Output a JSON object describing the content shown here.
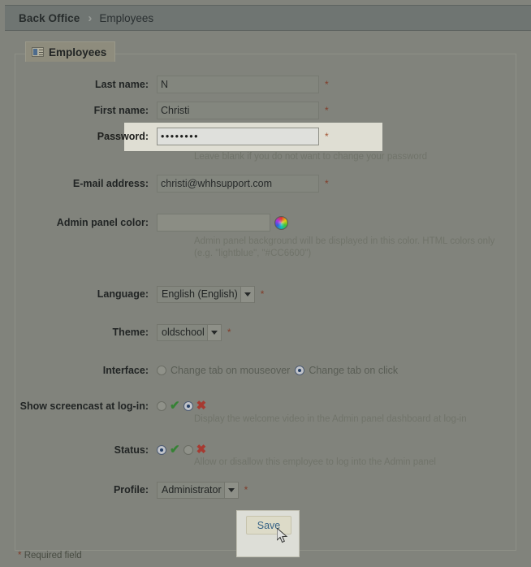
{
  "breadcrumb": {
    "root": "Back Office",
    "separator": "›",
    "leaf": "Employees"
  },
  "fieldset": {
    "legend": "Employees",
    "legend_icon": "contact-card-icon"
  },
  "form": {
    "last_name": {
      "label": "Last name:",
      "value": "N",
      "required_marker": "*"
    },
    "first_name": {
      "label": "First name:",
      "value": "Christi",
      "required_marker": "*"
    },
    "password": {
      "label": "Password:",
      "value": "••••••••",
      "required_marker": "*",
      "hint": "Leave blank if you do not want to change your password"
    },
    "email": {
      "label": "E-mail address:",
      "value": "christi@whhsupport.com",
      "required_marker": "*"
    },
    "admin_panel_color": {
      "label": "Admin panel color:",
      "value": "",
      "picker_icon": "color-wheel-icon",
      "hint": "Admin panel background will be displayed in this color. HTML colors only (e.g. \"lightblue\", \"#CC6600\")"
    },
    "language": {
      "label": "Language:",
      "value": "English (English)",
      "required_marker": "*",
      "arrow_icon": "chevron-down-icon"
    },
    "theme": {
      "label": "Theme:",
      "value": "oldschool",
      "required_marker": "*",
      "arrow_icon": "chevron-down-icon"
    },
    "interface": {
      "label": "Interface:",
      "options": [
        {
          "text": "Change tab on mouseover",
          "selected": false
        },
        {
          "text": "Change tab on click",
          "selected": true
        }
      ]
    },
    "screencast": {
      "label": "Show screencast at log-in:",
      "yes_icon": "check-icon",
      "no_icon": "cross-icon",
      "yes_selected": false,
      "no_selected": true,
      "hint": "Display the welcome video in the Admin panel dashboard at log-in"
    },
    "status": {
      "label": "Status:",
      "yes_icon": "check-icon",
      "no_icon": "cross-icon",
      "yes_selected": true,
      "no_selected": false,
      "hint": "Allow or disallow this employee to log into the Admin panel"
    },
    "profile": {
      "label": "Profile:",
      "value": "Administrator",
      "required_marker": "*",
      "arrow_icon": "chevron-down-icon"
    }
  },
  "actions": {
    "save_label": "Save"
  },
  "footer": {
    "required_star": "*",
    "required_text": "Required field"
  },
  "icons": {
    "check": "✔",
    "cross": "✖"
  }
}
